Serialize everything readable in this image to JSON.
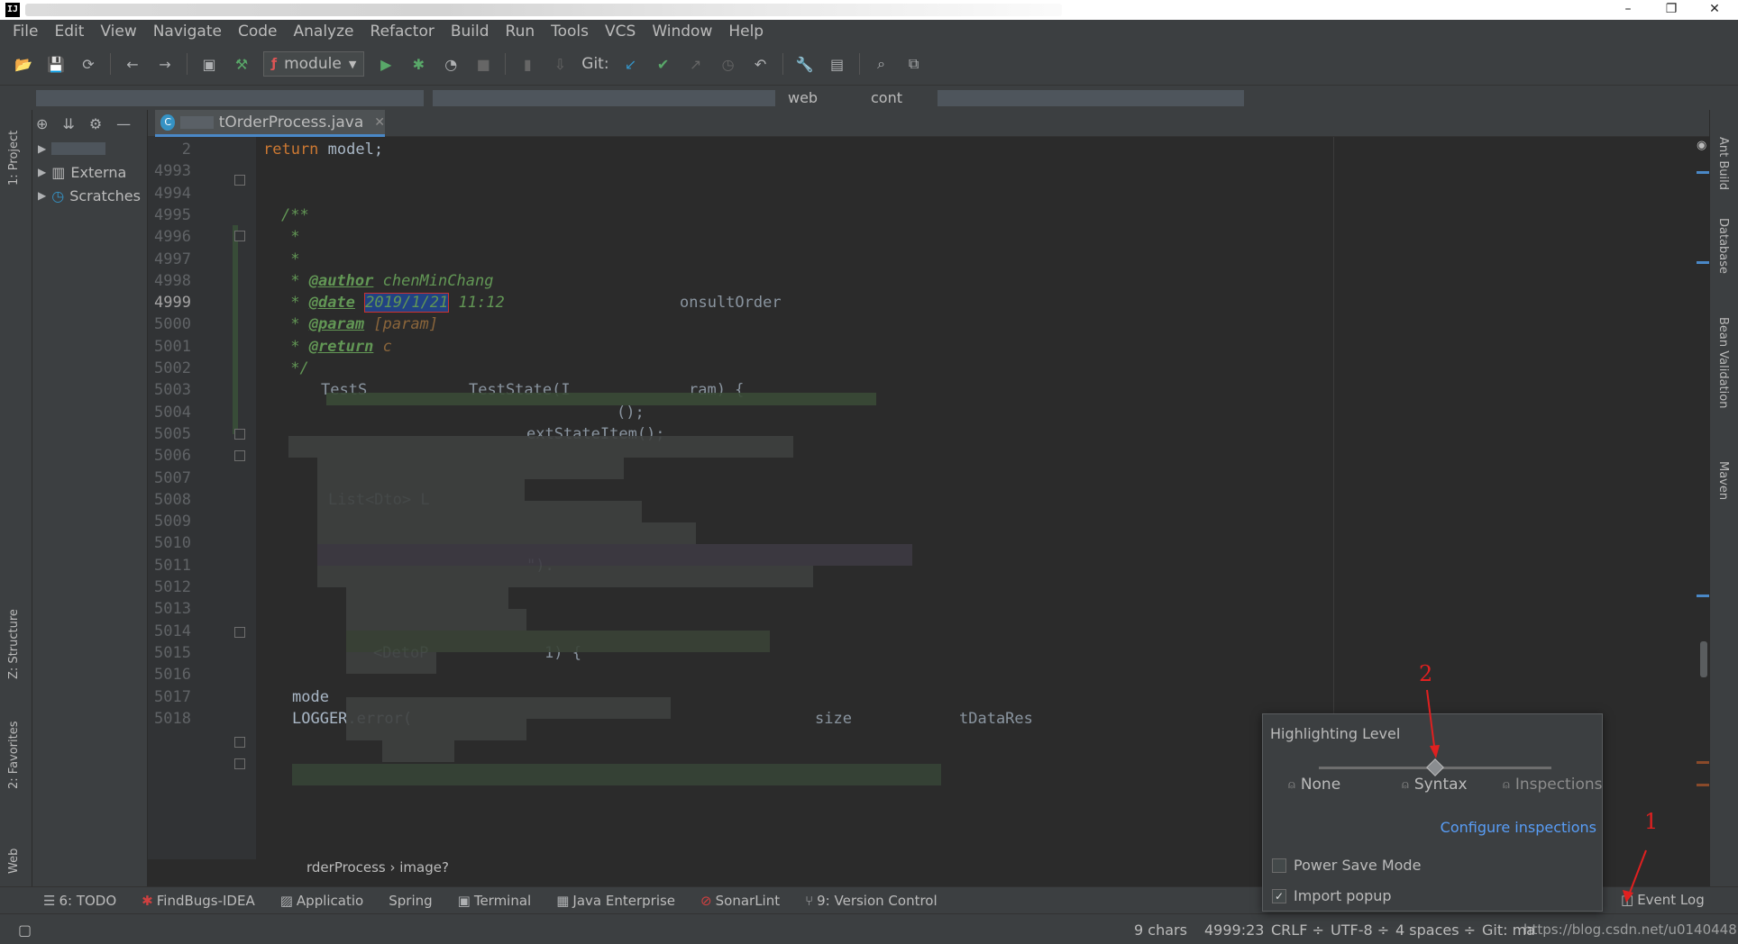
{
  "window": {
    "app_icon": "IJ",
    "controls": {
      "minimize": "–",
      "restore": "❐",
      "close": "✕"
    }
  },
  "menu": [
    "File",
    "Edit",
    "View",
    "Navigate",
    "Code",
    "Analyze",
    "Refactor",
    "Build",
    "Run",
    "Tools",
    "VCS",
    "Window",
    "Help"
  ],
  "toolbar": {
    "run_config": "module",
    "git_label": "Git:"
  },
  "navbar": {
    "crumbs": [
      "web",
      "cont"
    ]
  },
  "left_tabs": {
    "project": "1: Project",
    "structure": "Z: Structure",
    "favorites": "2: Favorites",
    "web": "Web"
  },
  "right_tabs": {
    "ant": "Ant Build",
    "database": "Database",
    "bean": "Bean Validation",
    "maven": "Maven"
  },
  "project_tree": [
    {
      "label": "Externa"
    },
    {
      "label": "Scratches"
    }
  ],
  "editor": {
    "tab_label": "tOrderProcess.java",
    "lines": [
      {
        "n": "2",
        "text": "return model;"
      },
      {
        "n": "4993",
        "text": "}"
      },
      {
        "n": "4994",
        "text": ""
      },
      {
        "n": "4995",
        "text": "/**"
      },
      {
        "n": "4996",
        "text": " *"
      },
      {
        "n": "4997",
        "text": " *"
      },
      {
        "n": "4998",
        "tag": "@author",
        "rest": " chenMinChang"
      },
      {
        "n": "4999",
        "tag": "@date",
        "sel": "2019/1/21",
        "rest": " 11:12"
      },
      {
        "n": "5000",
        "tag": "@param",
        "rest": " [param]"
      },
      {
        "n": "5001",
        "tag": "@return",
        "rest": " c"
      },
      {
        "n": "5002",
        "text": " */"
      },
      {
        "n": "5003",
        "text": ""
      },
      {
        "n": "5004",
        "text": ""
      },
      {
        "n": "5005",
        "text": ""
      },
      {
        "n": "5006",
        "text": ""
      },
      {
        "n": "5007",
        "text": ""
      },
      {
        "n": "5008",
        "text": ""
      },
      {
        "n": "5009",
        "text": ""
      },
      {
        "n": "5010",
        "text": ""
      },
      {
        "n": "5011",
        "text": ""
      },
      {
        "n": "5012",
        "text": ""
      },
      {
        "n": "5013",
        "text": ""
      },
      {
        "n": "5014",
        "text": ""
      },
      {
        "n": "5015",
        "text": ""
      },
      {
        "n": "5016",
        "text": ""
      },
      {
        "n": "5017",
        "text": "mode"
      },
      {
        "n": "5018",
        "text": "LOGGER.error("
      }
    ],
    "code_fragments": {
      "f5001": "onsultOrder",
      "f5003a": "TestS",
      "f5003b": "TestState(I",
      "f5003c": "ram) {",
      "f5004": "();",
      "f5005": "extStateItem();",
      "f5008": "List<Dto> L",
      "f5011": "\").",
      "f5015a": "<DetoP",
      "f5015b": "1) {",
      "f5018": "size",
      "f5018b": "tDataRes"
    },
    "breadcrumb": "rderProcess  ›  image?"
  },
  "tool_windows": [
    "6: TODO",
    "FindBugs-IDEA",
    "Applicatio",
    "Spring",
    "Terminal",
    "Java Enterprise",
    "SonarLint",
    "9: Version Control",
    "Event Log"
  ],
  "status": {
    "chars": "9 chars",
    "position": "4999:23",
    "line_sep": "CRLF ÷",
    "encoding": "UTF-8 ÷",
    "indent": "4 spaces ÷",
    "git": "Git: ma",
    "watermark": "https://blog.csdn.net/u014044812"
  },
  "popup": {
    "title": "Highlighting Level",
    "levels": [
      "None",
      "Syntax",
      "Inspections"
    ],
    "selected_level": "Syntax",
    "configure_link": "Configure inspections",
    "power_save": {
      "label": "Power Save Mode",
      "checked": false
    },
    "import_popup": {
      "label": "Import popup",
      "checked": true,
      "mark": "✓"
    }
  },
  "annotations": {
    "one": "1",
    "two": "2"
  },
  "colors": {
    "accent": "#4a88c7",
    "link": "#589df6",
    "annotation": "#e02020",
    "comment": "#629755",
    "keyword": "#cc7832"
  }
}
